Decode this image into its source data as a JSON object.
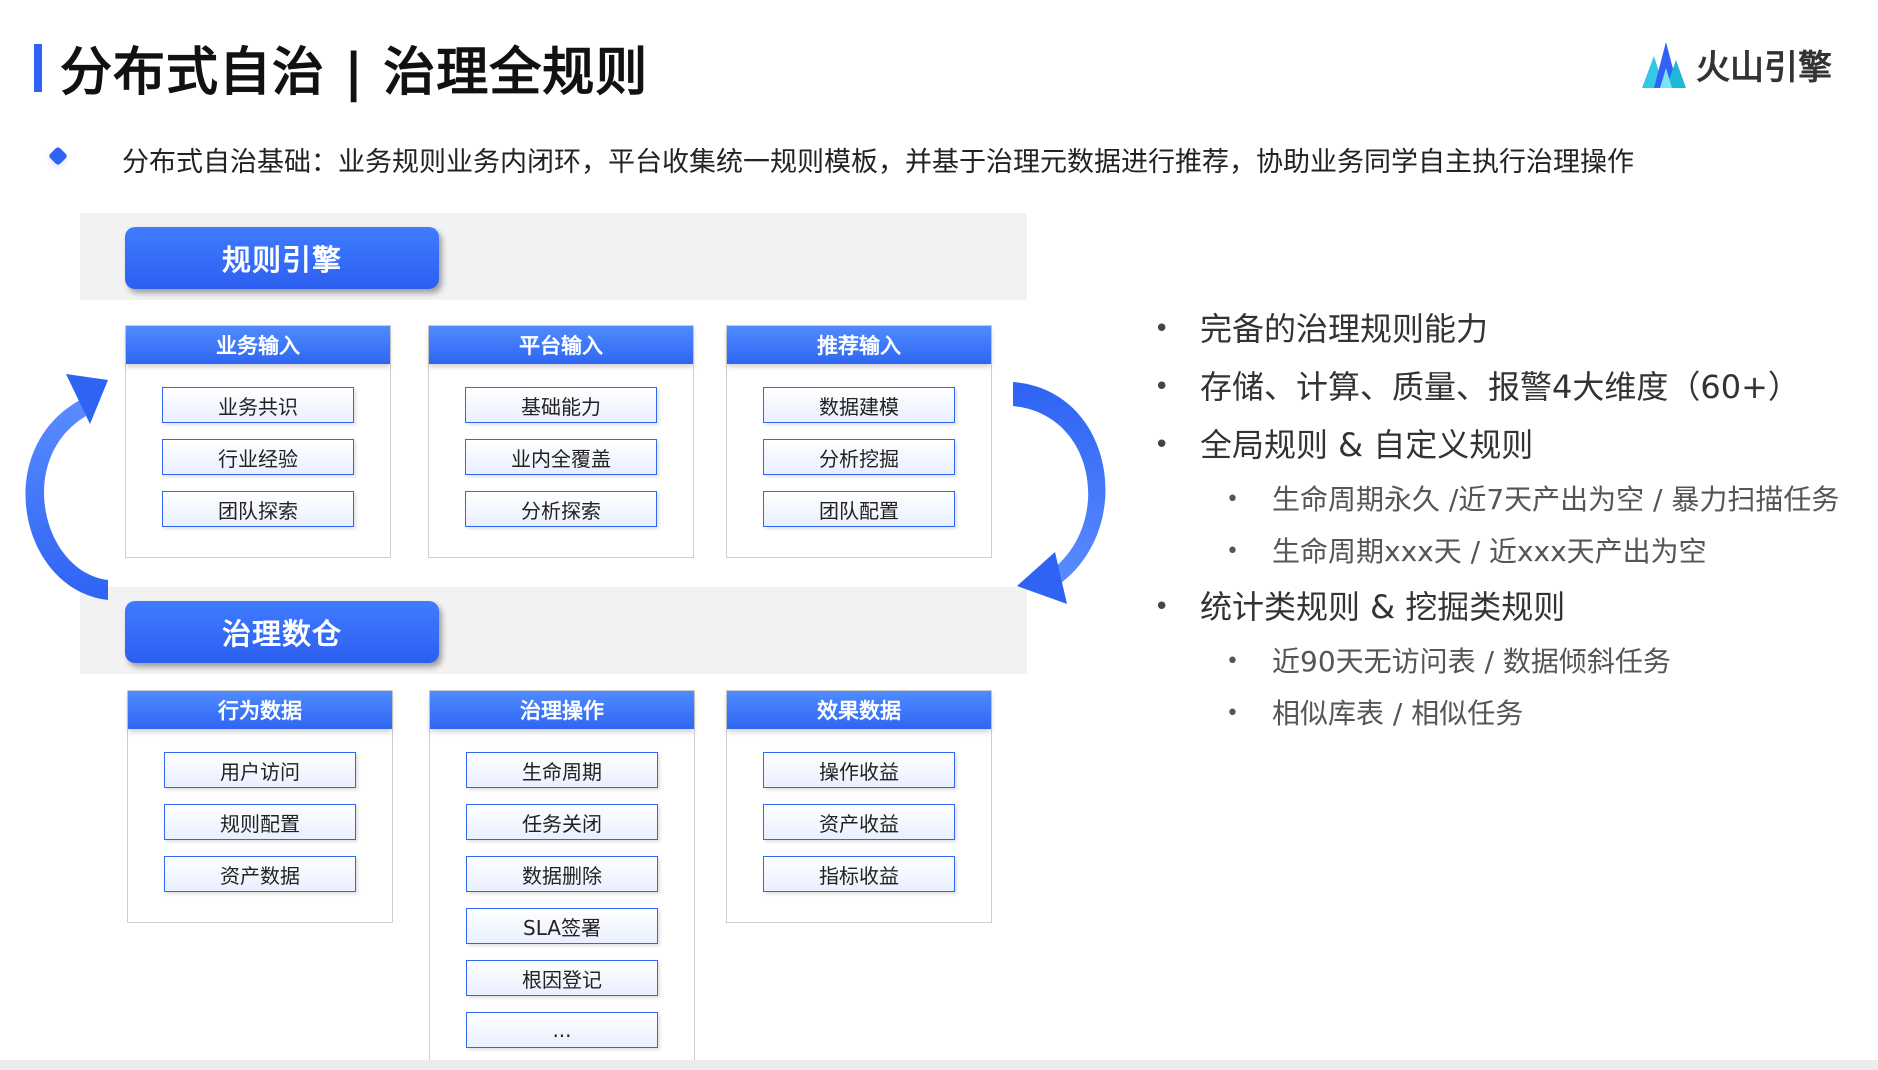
{
  "header": {
    "title": "分布式自治 | 治理全规则",
    "brand_name": "火山引擎"
  },
  "subtitle": "分布式自治基础：业务规则业务内闭环，平台收集统一规则模板，并基于治理元数据进行推荐，协助业务同学自主执行治理操作",
  "diagram": {
    "top_label": "规则引擎",
    "mid_label": "治理数仓",
    "top_panels": [
      {
        "title": "业务输入",
        "items": [
          "业务共识",
          "行业经验",
          "团队探索"
        ]
      },
      {
        "title": "平台输入",
        "items": [
          "基础能力",
          "业内全覆盖",
          "分析探索"
        ]
      },
      {
        "title": "推荐输入",
        "items": [
          "数据建模",
          "分析挖掘",
          "团队配置"
        ]
      }
    ],
    "bottom_panels": [
      {
        "title": "行为数据",
        "items": [
          "用户访问",
          "规则配置",
          "资产数据"
        ]
      },
      {
        "title": "治理操作",
        "items": [
          "生命周期",
          "任务关闭",
          "数据删除",
          "SLA签署",
          "根因登记",
          "..."
        ]
      },
      {
        "title": "效果数据",
        "items": [
          "操作收益",
          "资产收益",
          "指标收益"
        ]
      }
    ]
  },
  "bullets": {
    "b1": "完备的治理规则能力",
    "b2": "存储、计算、质量、报警4大维度（60+）",
    "b3": "全局规则 & 自定义规则",
    "b3_sub1": "生命周期永久 /近7天产出为空 / 暴力扫描任务",
    "b3_sub2": "生命周期xxx天 / 近xxx天产出为空",
    "b4": "统计类规则 & 挖掘类规则",
    "b4_sub1": "近90天无访问表 / 数据倾斜任务",
    "b4_sub2": "相似库表 / 相似任务"
  },
  "colors": {
    "accent": "#2e63f4",
    "panel_header": "#3a73f7",
    "band": "#f2f2f2"
  }
}
